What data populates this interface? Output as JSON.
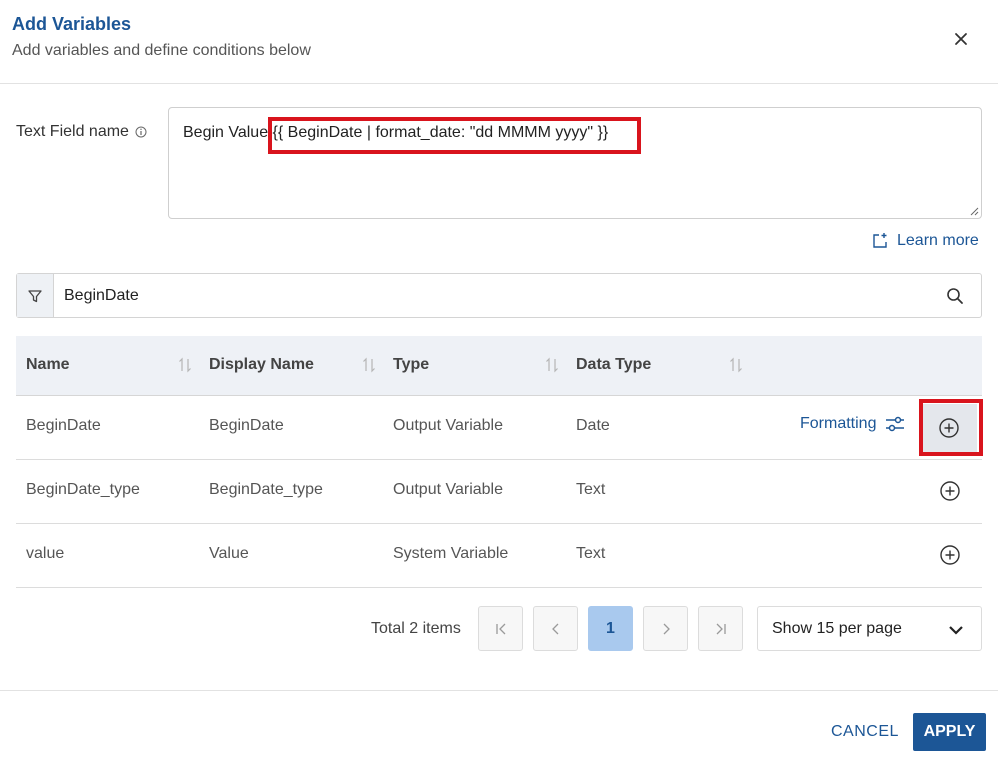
{
  "header": {
    "title": "Add Variables",
    "subtitle": "Add variables and define conditions below",
    "close_icon": "close-icon"
  },
  "text_field": {
    "label": "Text Field name",
    "info_icon": "info-icon",
    "value_prefix": "Begin Value ",
    "value_expression": "{{ BeginDate | format_date: \"dd MMMM yyyy\" }}"
  },
  "learn_more": {
    "label": "Learn more",
    "icon": "external-link-icon"
  },
  "search": {
    "value": "BeginDate",
    "filter_icon": "filter-icon",
    "search_icon": "search-icon"
  },
  "table": {
    "columns": [
      "Name",
      "Display Name",
      "Type",
      "Data Type"
    ],
    "rows": [
      {
        "name": "BeginDate",
        "display_name": "BeginDate",
        "type": "Output Variable",
        "data_type": "Date",
        "formatting": "Formatting"
      },
      {
        "name": "BeginDate_type",
        "display_name": "BeginDate_type",
        "type": "Output Variable",
        "data_type": "Text"
      },
      {
        "name": "value",
        "display_name": "Value",
        "type": "System Variable",
        "data_type": "Text"
      }
    ]
  },
  "pagination": {
    "total": "Total 2 items",
    "current_page": "1",
    "per_page": "Show 15 per page"
  },
  "footer": {
    "cancel": "CANCEL",
    "apply": "APPLY"
  },
  "colors": {
    "accent": "#1c5696",
    "highlight": "#d9141d",
    "current_page_bg": "#a9c9ee"
  }
}
